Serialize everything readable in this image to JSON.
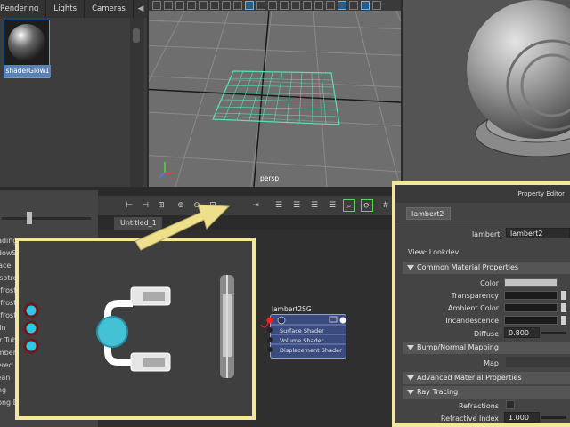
{
  "top_left_panel": {
    "tabs": [
      "Rendering",
      "Lights",
      "Cameras"
    ],
    "swatch_label": "shaderGlow1"
  },
  "viewport": {
    "camera_label": "persp"
  },
  "node_editor": {
    "tab_label": "Untitled_1",
    "node": {
      "title": "lambert2SG",
      "ports": [
        "Surface Shader",
        "Volume Shader",
        "Displacement Shader"
      ]
    }
  },
  "outliner": {
    "items": [
      "nadingMap",
      "adowShader",
      "rface",
      "nisotropic",
      "rnfrost",
      "rnfrost",
      "rnfrost",
      "ulin",
      "air Tube",
      "ambert",
      "yered",
      "cean",
      "ong",
      "hong E"
    ]
  },
  "property_editor": {
    "header": "Property Editor",
    "tab": "lambert2",
    "name_label": "lambert:",
    "name_value": "lambert2",
    "view_label": "View: Lookdev",
    "sections": {
      "common": "Common Material Properties",
      "bump": "Bump/Normal Mapping",
      "advanced": "Advanced Material Properties",
      "raytracing": "Ray Tracing"
    },
    "attributes": {
      "color": "Color",
      "transparency": "Transparency",
      "ambient": "Ambient Color",
      "incandescence": "Incandescence",
      "diffuse": "Diffuse",
      "diffuse_value": "0.800",
      "map": "Map",
      "refractions": "Refractions",
      "refractive_index": "Refractive Index",
      "refractive_index_value": "1.000"
    }
  },
  "colors": {
    "highlight_frame": "#f2e7a0",
    "arrow": "#eee08a",
    "grid_select": "#58e0b0",
    "port_input": "#2ec6e0",
    "port_output": "#ff2020"
  }
}
